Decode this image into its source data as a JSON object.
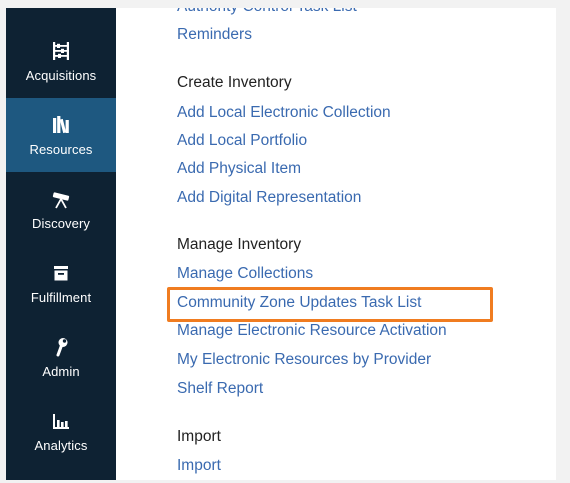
{
  "sidebar": {
    "items": [
      {
        "label": "Acquisitions",
        "icon": "abacus-icon",
        "active": false
      },
      {
        "label": "Resources",
        "icon": "books-icon",
        "active": true
      },
      {
        "label": "Discovery",
        "icon": "telescope-icon",
        "active": false
      },
      {
        "label": "Fulfillment",
        "icon": "tray-icon",
        "active": false
      },
      {
        "label": "Admin",
        "icon": "wrench-icon",
        "active": false
      },
      {
        "label": "Analytics",
        "icon": "bar-chart-icon",
        "active": false
      }
    ]
  },
  "menu": {
    "partial_top_link": "Authority Control Task List",
    "top_links": [
      "Reminders"
    ],
    "sections": [
      {
        "title": "Create Inventory",
        "links": [
          "Add Local Electronic Collection",
          "Add Local Portfolio",
          "Add Physical Item",
          "Add Digital Representation"
        ]
      },
      {
        "title": "Manage Inventory",
        "links": [
          "Manage Collections",
          "Community Zone Updates Task List",
          "Manage Electronic Resource Activation",
          "My Electronic Resources by Provider",
          "Shelf Report"
        ]
      },
      {
        "title": "Import",
        "links": [
          "Import"
        ]
      }
    ]
  },
  "colors": {
    "sidebar_bg": "#0e2233",
    "sidebar_active": "#1e5880",
    "link": "#3a6ab0",
    "highlight": "#f07c20"
  }
}
